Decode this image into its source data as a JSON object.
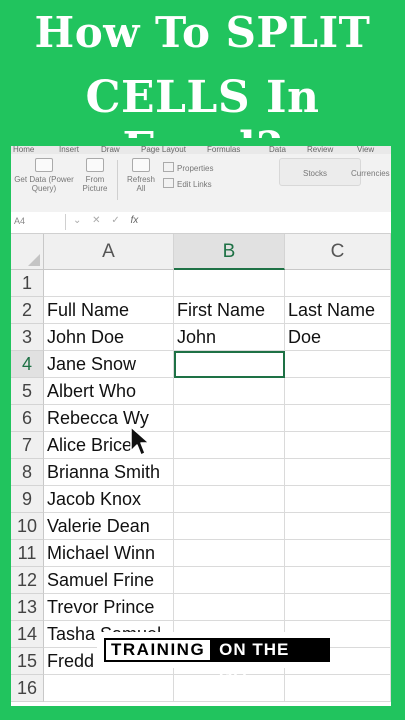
{
  "title": {
    "line1": "How To SPLIT",
    "line2": "CELLS In Excel?"
  },
  "ribbon_tabs": [
    "Home",
    "Insert",
    "Draw",
    "Page Layout",
    "Formulas",
    "Data",
    "Review",
    "View"
  ],
  "ribbon": {
    "get_data": "Get Data (Power Query)",
    "from_picture": "From Picture",
    "refresh_all": "Refresh All",
    "properties": "Properties",
    "edit_links": "Edit Links",
    "stocks": "Stocks",
    "currencies": "Currencies"
  },
  "formula_bar": {
    "name_box": "A4",
    "fx": "fx"
  },
  "columns": [
    "A",
    "B",
    "C"
  ],
  "rows": [
    {
      "num": "1",
      "a": "",
      "b": "",
      "c": ""
    },
    {
      "num": "2",
      "a": "Full Name",
      "b": "First Name",
      "c": "Last Name"
    },
    {
      "num": "3",
      "a": "John Doe",
      "b": "John",
      "c": "Doe"
    },
    {
      "num": "4",
      "a": "Jane Snow",
      "b": "",
      "c": ""
    },
    {
      "num": "5",
      "a": "Albert Who",
      "b": "",
      "c": ""
    },
    {
      "num": "6",
      "a": "Rebecca Wy",
      "b": "",
      "c": ""
    },
    {
      "num": "7",
      "a": "Alice Brice",
      "b": "",
      "c": ""
    },
    {
      "num": "8",
      "a": "Brianna Smith",
      "b": "",
      "c": ""
    },
    {
      "num": "9",
      "a": "Jacob Knox",
      "b": "",
      "c": ""
    },
    {
      "num": "10",
      "a": "Valerie Dean",
      "b": "",
      "c": ""
    },
    {
      "num": "11",
      "a": "Michael Winn",
      "b": "",
      "c": ""
    },
    {
      "num": "12",
      "a": "Samuel Frine",
      "b": "",
      "c": ""
    },
    {
      "num": "13",
      "a": "Trevor Prince",
      "b": "",
      "c": ""
    },
    {
      "num": "14",
      "a": "Tasha Samuel",
      "b": "",
      "c": ""
    },
    {
      "num": "15",
      "a": "Fredd",
      "b": "",
      "c": ""
    },
    {
      "num": "16",
      "a": "",
      "b": "",
      "c": ""
    }
  ],
  "selected_column": "B",
  "active_cell": "B4",
  "badge": {
    "part1": "TRAINING",
    "part2": "ON THE GO"
  },
  "colors": {
    "brand_green": "#21c45e",
    "excel_green": "#1e7145"
  }
}
